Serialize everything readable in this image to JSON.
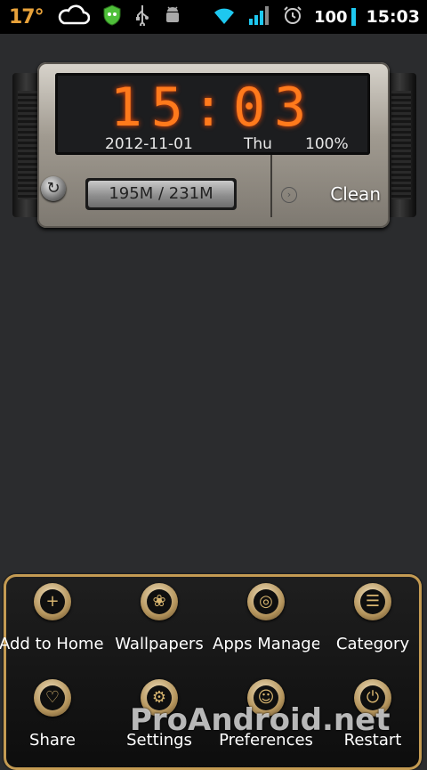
{
  "statusbar": {
    "temperature": "17°",
    "battery": "100",
    "time": "15:03",
    "icons": [
      "cloud-icon",
      "shield-icon",
      "usb-icon",
      "android-debug-icon",
      "wifi-icon",
      "signal-icon",
      "alarm-icon"
    ]
  },
  "widget": {
    "time": "15:03",
    "date": "2012-11-01",
    "day": "Thu",
    "battery_pct": "100%",
    "memory": "195M / 231M",
    "clean_label": "Clean"
  },
  "menu": {
    "items": [
      {
        "label": "Add to Home Screen",
        "icon": "plus-icon"
      },
      {
        "label": "Wallpapers",
        "icon": "flower-icon"
      },
      {
        "label": "Apps Manager",
        "icon": "target-icon"
      },
      {
        "label": "Category",
        "icon": "list-icon"
      },
      {
        "label": "Share",
        "icon": "heart-icon"
      },
      {
        "label": "Settings",
        "icon": "gear-icon"
      },
      {
        "label": "Preferences",
        "icon": "face-icon"
      },
      {
        "label": "Restart",
        "icon": "power-icon"
      }
    ]
  },
  "watermark": "ProAndroid.net",
  "colors": {
    "accent": "#ff7a1c",
    "battery": "#1ec8f0",
    "temp": "#e8a23a",
    "frame": "#c49b53"
  }
}
